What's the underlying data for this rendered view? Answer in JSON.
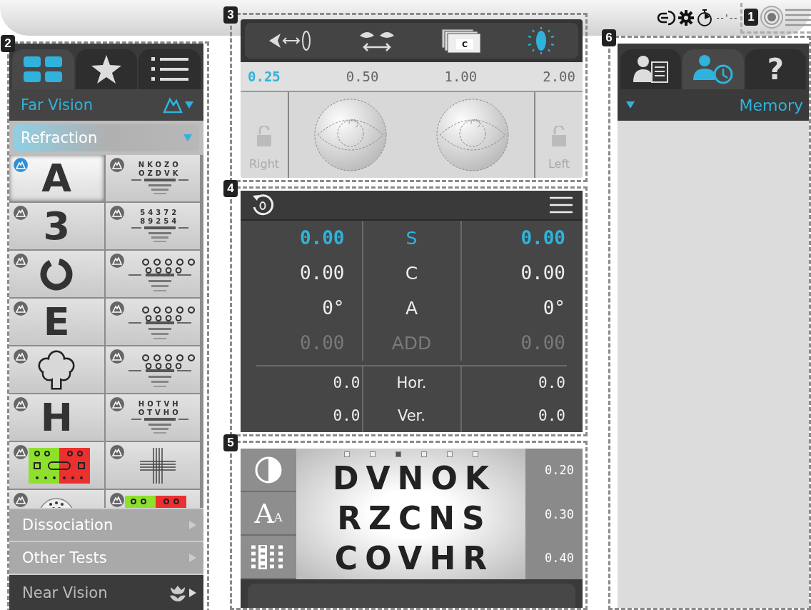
{
  "header": {
    "time": "--'--",
    "callout": "1"
  },
  "left_panel": {
    "callout": "2",
    "tabs": [
      {
        "kind": "grid",
        "selected": true
      },
      {
        "kind": "star",
        "selected": false
      },
      {
        "kind": "list",
        "selected": false
      }
    ],
    "category": "Far Vision",
    "subcategory": "Refraction",
    "charts": [
      {
        "kind": "letter",
        "glyph": "A",
        "selected": true
      },
      {
        "kind": "letters",
        "lines": [
          "NKOZO",
          "OZDVK"
        ],
        "selected": false
      },
      {
        "kind": "letter",
        "glyph": "3",
        "selected": false
      },
      {
        "kind": "letters",
        "lines": [
          "54372",
          "89254"
        ],
        "selected": false
      },
      {
        "kind": "ring",
        "selected": false
      },
      {
        "kind": "symbols",
        "selected": false
      },
      {
        "kind": "letter",
        "glyph": "E",
        "selected": false
      },
      {
        "kind": "symbols",
        "selected": false
      },
      {
        "kind": "tree",
        "selected": false
      },
      {
        "kind": "symbols",
        "selected": false
      },
      {
        "kind": "letter",
        "glyph": "H",
        "selected": false
      },
      {
        "kind": "letters",
        "lines": [
          "HOTVH",
          "OTVHO"
        ],
        "selected": false
      },
      {
        "kind": "duochrome",
        "selected": false
      },
      {
        "kind": "cross",
        "selected": false
      },
      {
        "kind": "dots",
        "selected": false
      },
      {
        "kind": "duochrome",
        "selected": false
      }
    ],
    "sections": [
      {
        "label": "Dissociation",
        "kind": "light"
      },
      {
        "label": "Other Tests",
        "kind": "light"
      },
      {
        "label": "Near Vision",
        "kind": "dark"
      }
    ]
  },
  "lens_panel": {
    "callout": "3",
    "tools": [
      {
        "kind": "vertex",
        "selected": false
      },
      {
        "kind": "pd",
        "selected": false
      },
      {
        "kind": "card",
        "label": "C",
        "selected": false
      },
      {
        "kind": "lens",
        "selected": true
      }
    ],
    "steps": [
      {
        "value": "0.25",
        "selected": true
      },
      {
        "value": "0.50",
        "selected": false
      },
      {
        "value": "1.00",
        "selected": false
      },
      {
        "value": "2.00",
        "selected": false
      }
    ],
    "locks": [
      {
        "label": "Right"
      },
      {
        "label": "Left"
      }
    ]
  },
  "refraction_panel": {
    "callout": "4",
    "rows": [
      {
        "right_eye": "0.00",
        "label": "S",
        "left_eye": "0.00",
        "selected": true,
        "disabled": false
      },
      {
        "right_eye": "0.00",
        "label": "C",
        "left_eye": "0.00",
        "selected": false,
        "disabled": false
      },
      {
        "right_eye": "0°",
        "label": "A",
        "left_eye": "0°",
        "selected": false,
        "disabled": false
      },
      {
        "right_eye": "0.00",
        "label": "ADD",
        "left_eye": "0.00",
        "selected": false,
        "disabled": true
      }
    ],
    "prism_rows": [
      {
        "right_eye": "0.0",
        "label": "Hor.",
        "left_eye": "0.0"
      },
      {
        "right_eye": "0.0",
        "label": "Ver.",
        "left_eye": "0.0"
      }
    ]
  },
  "chart_panel": {
    "callout": "5",
    "modes": [
      {
        "kind": "contrast"
      },
      {
        "kind": "size",
        "large": "A",
        "small": "A"
      },
      {
        "kind": "grid"
      }
    ],
    "pages": [
      {
        "selected": false
      },
      {
        "selected": false
      },
      {
        "selected": true
      },
      {
        "selected": false
      },
      {
        "selected": false
      },
      {
        "selected": false
      }
    ],
    "lines": [
      {
        "letters": "DVNOK",
        "acuity": "0.20"
      },
      {
        "letters": "RZCNS",
        "acuity": "0.30"
      },
      {
        "letters": "COVHR",
        "acuity": "0.40"
      }
    ]
  },
  "right_panel": {
    "callout": "6",
    "tabs": [
      {
        "kind": "patient",
        "selected": false
      },
      {
        "kind": "memory",
        "selected": true
      },
      {
        "kind": "help",
        "label": "?",
        "selected": false
      }
    ],
    "dropdown": "Memory"
  }
}
